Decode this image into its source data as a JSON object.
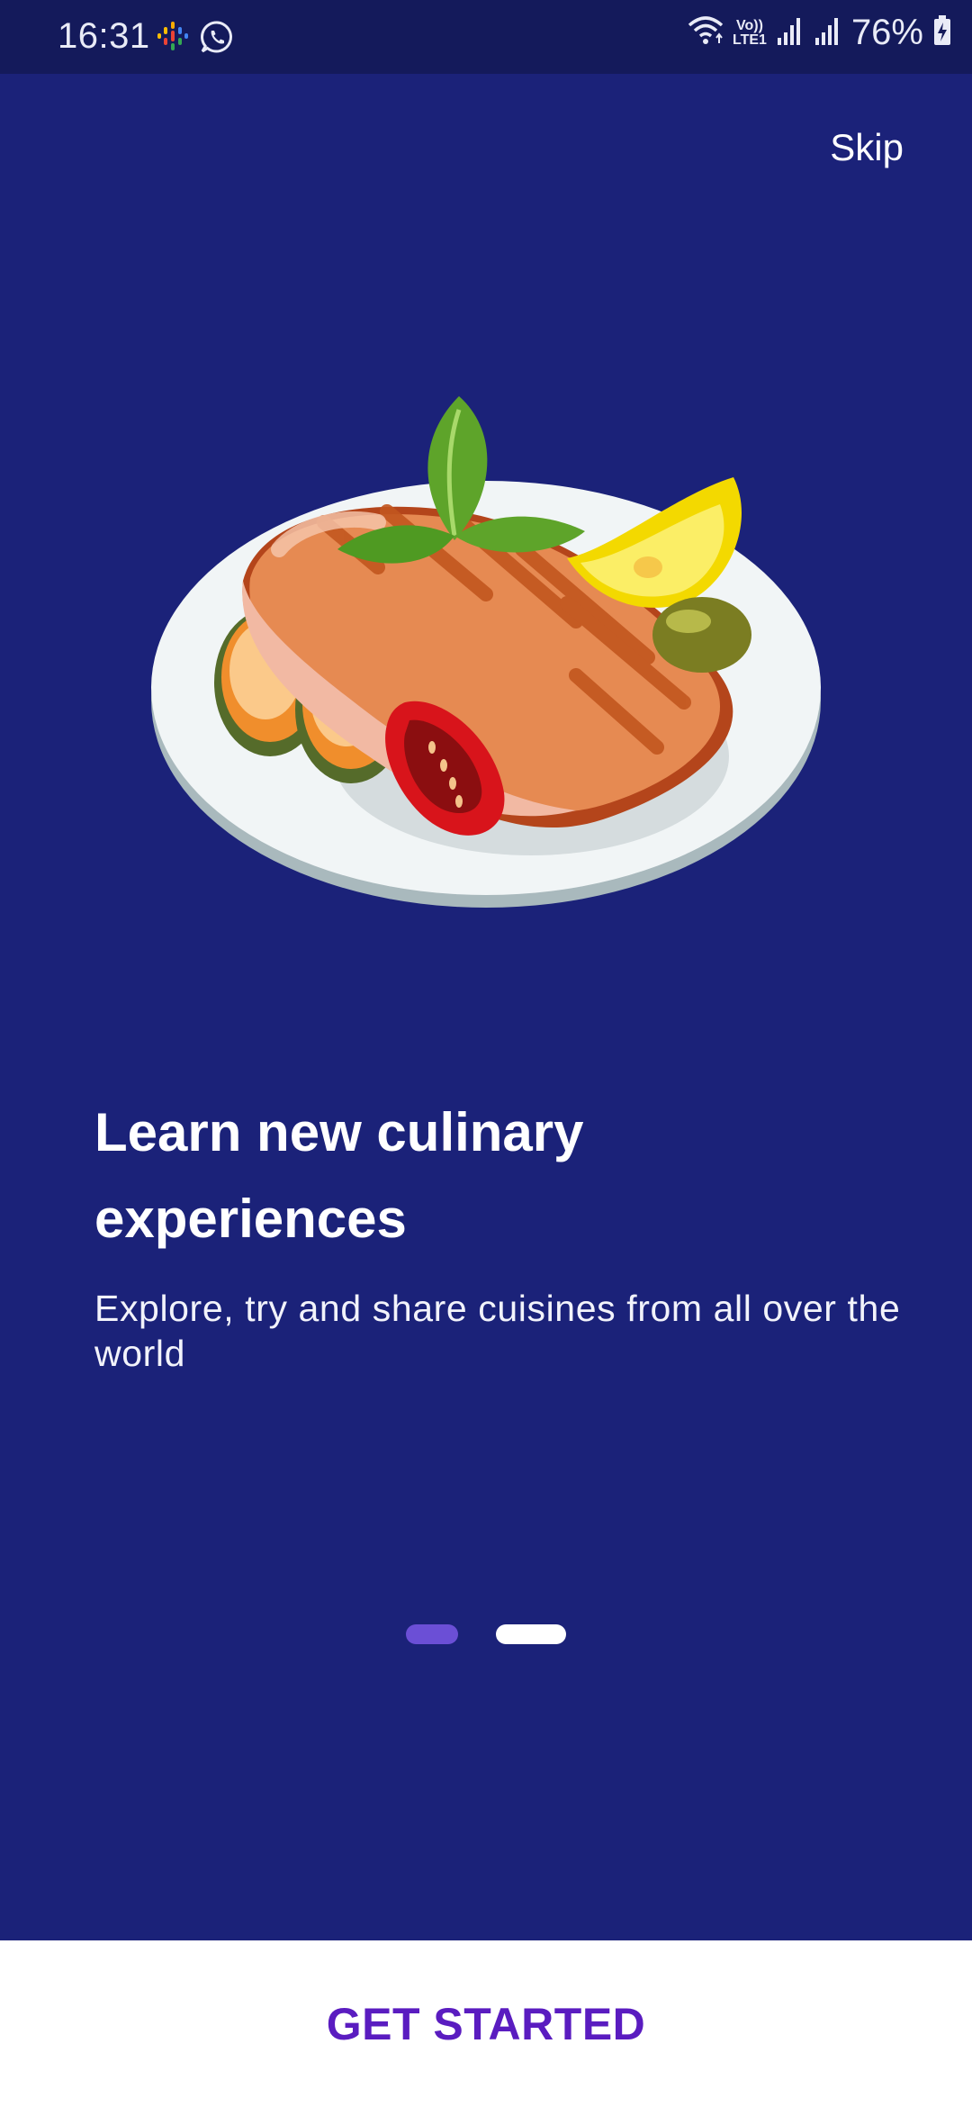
{
  "status_bar": {
    "time": "16:31",
    "volte_top": "Vo))",
    "volte_bottom": "LTE1",
    "battery_percent": "76%",
    "icons": [
      "google-podcasts-icon",
      "whatsapp-icon",
      "wifi-icon",
      "volte-icon",
      "signal-icon",
      "signal-icon",
      "battery-charging-icon"
    ]
  },
  "onboarding": {
    "skip_label": "Skip",
    "title": "Learn new culinary experiences",
    "subtitle": "Explore, try and share cuisines from all over the world",
    "illustration": "grilled-salmon-plate-illustration",
    "page_indicator": {
      "total_pages": 2,
      "current_page": 1
    },
    "cta_label": "GET STARTED"
  },
  "colors": {
    "background": "#1b2279",
    "status_bar": "#141a5b",
    "indicator_active": "#6b4fd6",
    "indicator_inactive": "#ffffff",
    "cta_text": "#5a1cc0",
    "cta_background": "#ffffff"
  }
}
